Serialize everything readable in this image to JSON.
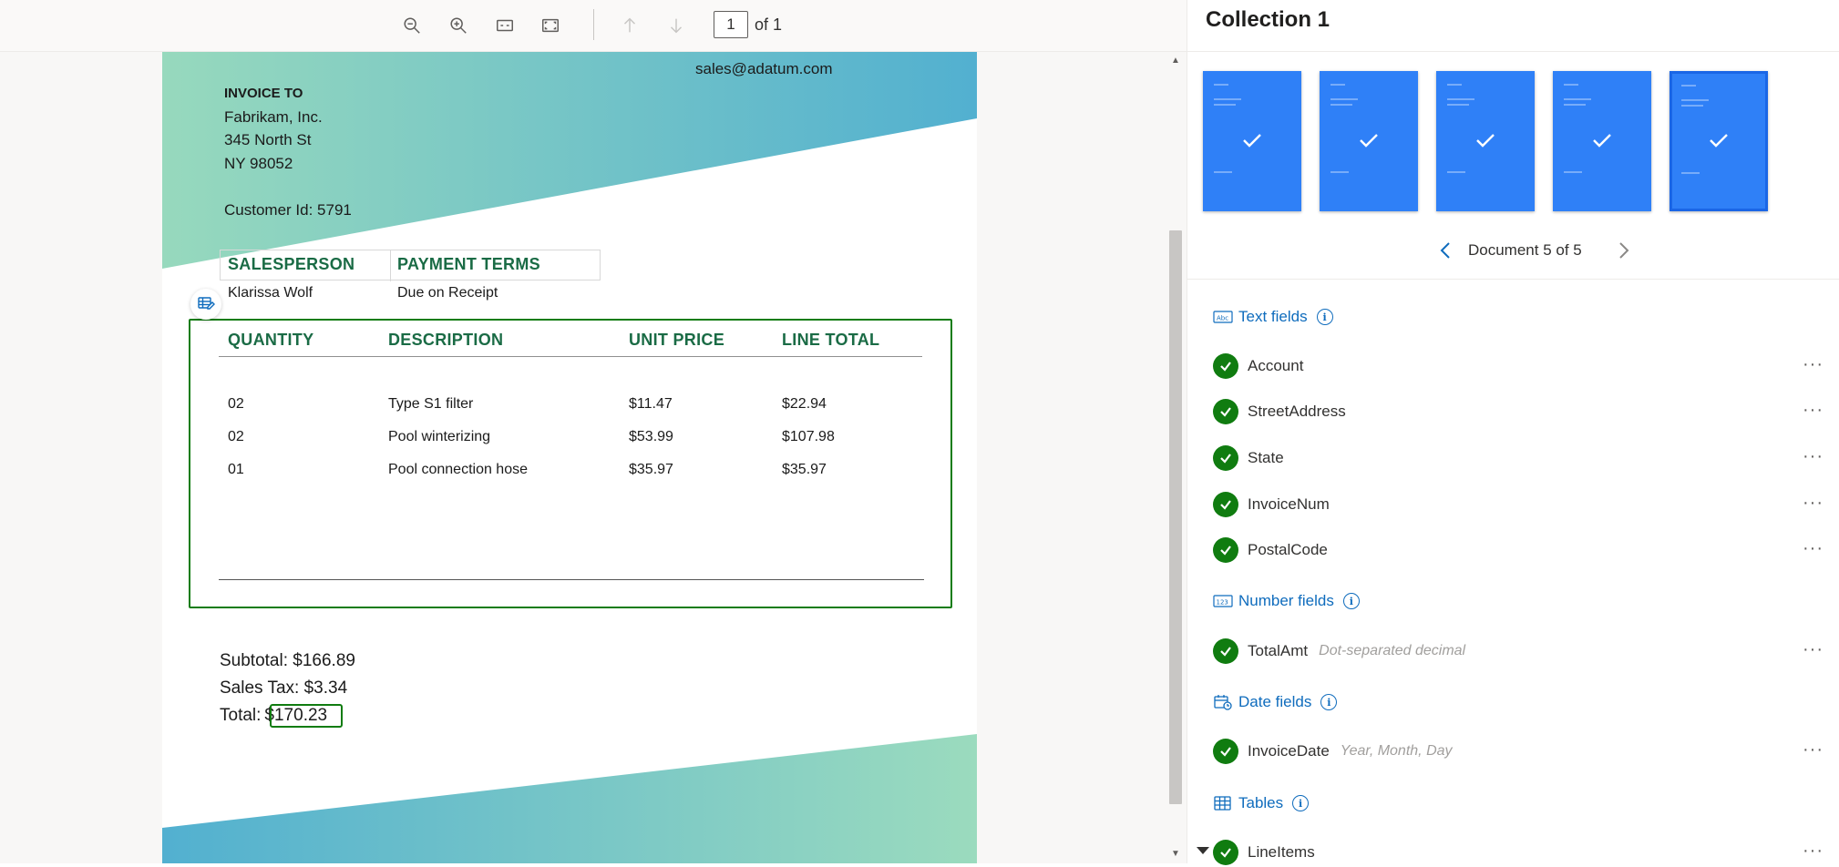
{
  "toolbar": {
    "page_current": "1",
    "page_total_label": "of 1"
  },
  "document": {
    "email": "sales@adatum.com",
    "invoice_to_label": "INVOICE TO",
    "customer_name": "Fabrikam, Inc.",
    "street": "345 North St",
    "state_zip": "NY 98052",
    "customer_id": "Customer Id: 5791",
    "salesperson_header": "SALESPERSON",
    "payment_terms_header": "PAYMENT TERMS",
    "salesperson": "Klarissa Wolf",
    "payment_terms": "Due on Receipt",
    "items_headers": [
      "QUANTITY",
      "DESCRIPTION",
      "UNIT PRICE",
      "LINE TOTAL"
    ],
    "items": [
      {
        "qty": "02",
        "desc": "Type S1 filter",
        "unit": "$11.47",
        "total": "$22.94"
      },
      {
        "qty": "02",
        "desc": "Pool winterizing",
        "unit": "$53.99",
        "total": "$107.98"
      },
      {
        "qty": "01",
        "desc": "Pool connection hose",
        "unit": "$35.97",
        "total": "$35.97"
      }
    ],
    "subtotal_label": "Subtotal:",
    "subtotal_value": "$166.89",
    "tax_label": "Sales Tax:",
    "tax_value": "$3.34",
    "total_label": "Total:",
    "total_value": "$170.23"
  },
  "panel": {
    "title": "Collection 1",
    "doc_nav_text": "Document 5 of 5",
    "thumbnail_count": 5,
    "selected_thumbnail": 5,
    "sections": {
      "text": "Text fields",
      "number": "Number fields",
      "date": "Date fields",
      "tables": "Tables"
    },
    "text_fields": [
      "Account",
      "StreetAddress",
      "State",
      "InvoiceNum",
      "PostalCode"
    ],
    "number_field": {
      "name": "TotalAmt",
      "hint": "Dot-separated decimal"
    },
    "date_field": {
      "name": "InvoiceDate",
      "hint": "Year, Month, Day"
    },
    "table_field": {
      "name": "LineItems"
    },
    "more_glyph": "···",
    "icons": [
      "zoom-out-icon",
      "zoom-in-icon",
      "fit-width-icon",
      "fit-page-icon",
      "arrow-up-icon",
      "arrow-down-icon",
      "table-tag-icon",
      "check-icon",
      "chevron-left-icon",
      "chevron-right-icon",
      "info-icon",
      "caret-down-icon"
    ],
    "colors": {
      "accent": "#0f6cbd",
      "success": "#107c10",
      "thumbnail": "#2f80f7"
    }
  }
}
